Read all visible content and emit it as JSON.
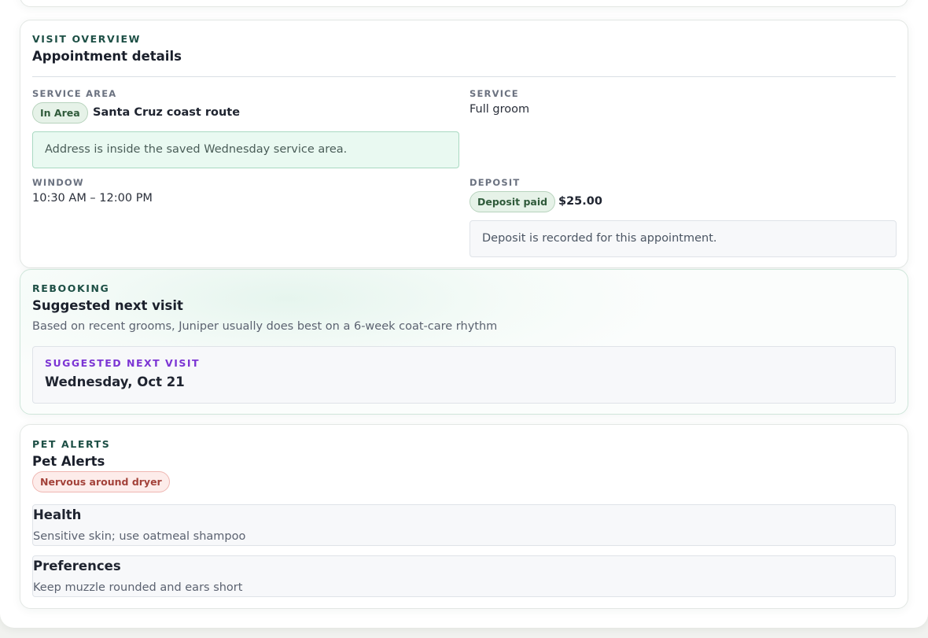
{
  "visit_overview": {
    "eyebrow": "VISIT OVERVIEW",
    "title": "Appointment details",
    "service_area": {
      "label": "SERVICE AREA",
      "badge": "In Area",
      "value": "Santa Cruz coast route",
      "notice": "Address is inside the saved Wednesday service area."
    },
    "service": {
      "label": "SERVICE",
      "value": "Full groom"
    },
    "window": {
      "label": "WINDOW",
      "value": "10:30 AM – 12:00 PM"
    },
    "deposit": {
      "label": "DEPOSIT",
      "badge": "Deposit paid",
      "amount": "$25.00",
      "notice": "Deposit is recorded for this appointment."
    }
  },
  "rebooking": {
    "eyebrow": "REBOOKING",
    "title": "Suggested next visit",
    "subtitle": "Based on recent grooms, Juniper usually does best on a 6-week coat-care rhythm",
    "suggestion_label": "SUGGESTED NEXT VISIT",
    "suggestion_date": "Wednesday, Oct 21"
  },
  "pet_alerts": {
    "eyebrow": "PET ALERTS",
    "title": "Pet Alerts",
    "badge": "Nervous around dryer",
    "items": [
      {
        "title": "Health",
        "body": "Sensitive skin; use oatmeal shampoo"
      },
      {
        "title": "Preferences",
        "body": "Keep muzzle rounded and ears short"
      }
    ]
  },
  "colors": {
    "accent_dark_green": "#1d4f45",
    "accent_purple": "#7c35d4",
    "success_bg": "#e9f9f1",
    "alert_red": "#a3423a"
  }
}
